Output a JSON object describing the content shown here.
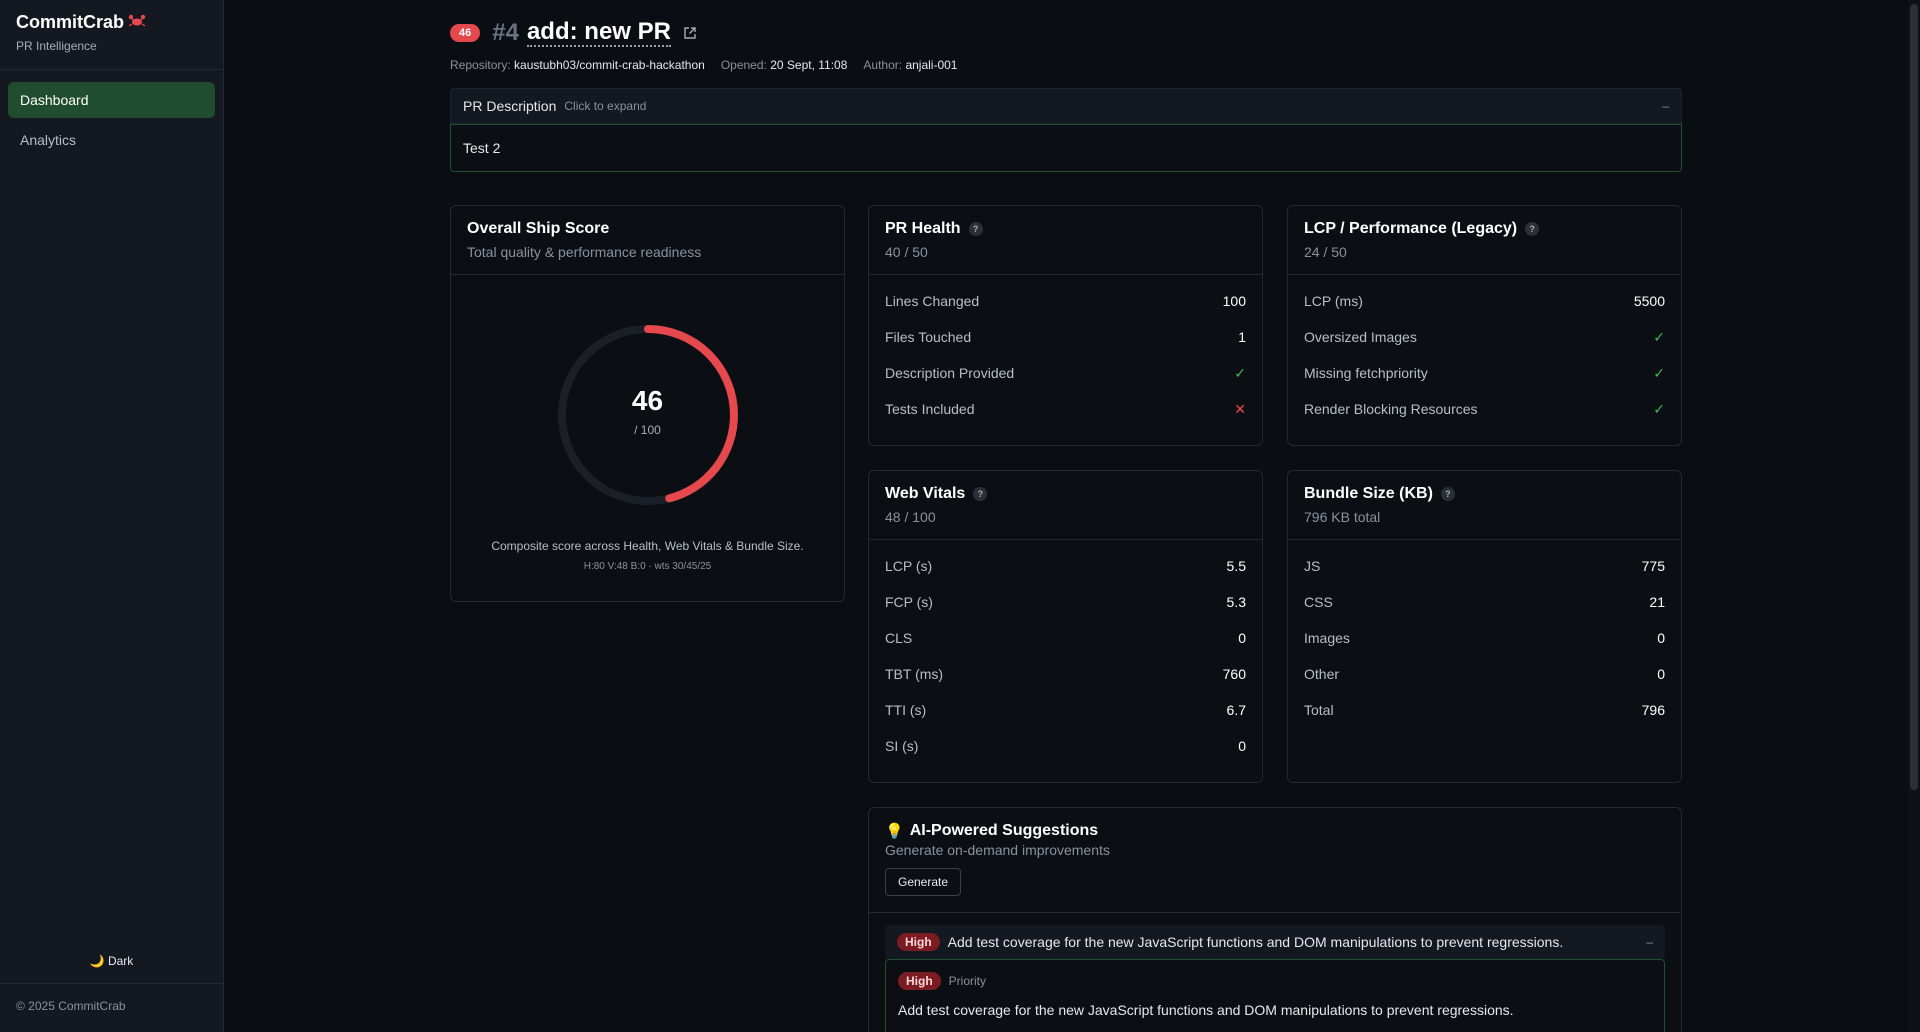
{
  "sidebar": {
    "brand": "CommitCrab",
    "brand_icon": "crab-icon",
    "subtitle": "PR Intelligence",
    "items": [
      {
        "label": "Dashboard",
        "active": true
      },
      {
        "label": "Analytics",
        "active": false
      }
    ],
    "theme_label": "🌙 Dark",
    "footer": "© 2025 CommitCrab"
  },
  "header": {
    "score_badge": "46",
    "pr_number": "#4",
    "pr_title": "add: new PR",
    "repository_label": "Repository:",
    "repository": "kaustubh03/commit-crab-hackathon",
    "opened_label": "Opened:",
    "opened": "20 Sept, 11:08",
    "author_label": "Author:",
    "author": "anjali-001"
  },
  "description": {
    "title": "PR Description",
    "hint": "Click to expand",
    "collapse": "–",
    "body": "Test 2"
  },
  "ship_score": {
    "title": "Overall Ship Score",
    "subtitle": "Total quality & performance readiness",
    "value": "46",
    "denominator": "/ 100",
    "fraction": 0.46,
    "note": "Composite score across Health, Web Vitals & Bundle Size.",
    "weights": "H:80 V:48 B:0 · wts 30/45/25",
    "color": "#e5484d"
  },
  "pr_health": {
    "title": "PR Health",
    "score": "40 / 50",
    "rows": [
      {
        "label": "Lines Changed",
        "value": "100"
      },
      {
        "label": "Files Touched",
        "value": "1"
      },
      {
        "label": "Description Provided",
        "value": "✓"
      },
      {
        "label": "Tests Included",
        "value": "✕"
      }
    ]
  },
  "lcp": {
    "title": "LCP / Performance (Legacy)",
    "score": "24 / 50",
    "rows": [
      {
        "label": "LCP (ms)",
        "value": "5500"
      },
      {
        "label": "Oversized Images",
        "value": "✓"
      },
      {
        "label": "Missing fetchpriority",
        "value": "✓"
      },
      {
        "label": "Render Blocking Resources",
        "value": "✓"
      }
    ]
  },
  "web_vitals": {
    "title": "Web Vitals",
    "score": "48 / 100",
    "rows": [
      {
        "label": "LCP (s)",
        "value": "5.5"
      },
      {
        "label": "FCP (s)",
        "value": "5.3"
      },
      {
        "label": "CLS",
        "value": "0"
      },
      {
        "label": "TBT (ms)",
        "value": "760"
      },
      {
        "label": "TTI (s)",
        "value": "6.7"
      },
      {
        "label": "SI (s)",
        "value": "0"
      }
    ]
  },
  "bundle": {
    "title": "Bundle Size (KB)",
    "total_label": "796 KB total",
    "rows": [
      {
        "label": "JS",
        "value": "775"
      },
      {
        "label": "CSS",
        "value": "21"
      },
      {
        "label": "Images",
        "value": "0"
      },
      {
        "label": "Other",
        "value": "0"
      },
      {
        "label": "Total",
        "value": "796"
      }
    ]
  },
  "ai": {
    "icon": "💡",
    "title": "AI-Powered Suggestions",
    "subtitle": "Generate on-demand improvements",
    "button": "Generate",
    "suggestion": {
      "priority": "High",
      "text": "Add test coverage for the new JavaScript functions and DOM manipulations to prevent regressions.",
      "collapse": "–",
      "priority_label": "Priority",
      "body": "Add test coverage for the new JavaScript functions and DOM manipulations to prevent regressions."
    }
  },
  "colors": {
    "accent_red": "#e5484d",
    "accent_green": "#3fb950",
    "active_nav": "#1f4d2e"
  }
}
